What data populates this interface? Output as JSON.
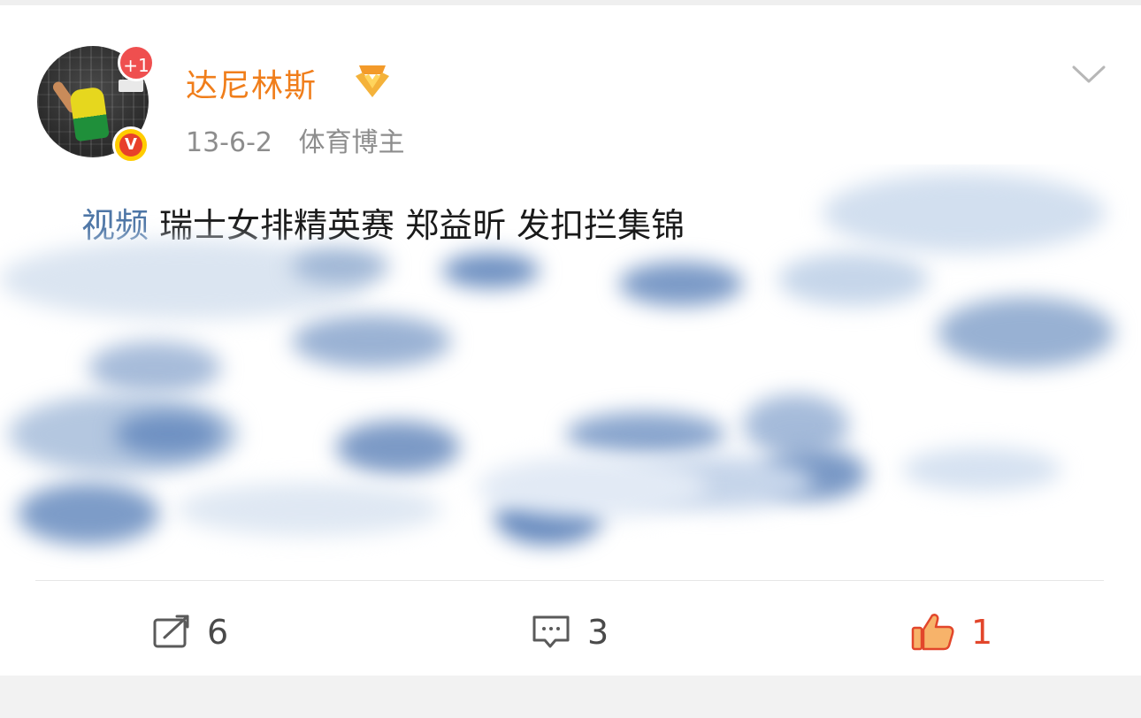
{
  "post": {
    "user": {
      "name": "达尼林斯",
      "plus_badge": "+1",
      "verified_badge": "V"
    },
    "meta": {
      "date": "13-6-2",
      "category": "体育博主"
    },
    "content": {
      "tag": "视频",
      "text": "瑞士女排精英赛 郑益昕 发扣拦集锦"
    },
    "actions": {
      "repost_count": "6",
      "comment_count": "3",
      "like_count": "1"
    }
  },
  "colors": {
    "username": "#f07e1b",
    "tag": "#4e76a6",
    "like": "#e2462b",
    "meta": "#8d8d8d"
  },
  "icons": {
    "more": "chevron-down-icon",
    "repost": "repost-icon",
    "comment": "comment-icon",
    "like": "thumbs-up-icon",
    "medal": "medal-icon"
  }
}
